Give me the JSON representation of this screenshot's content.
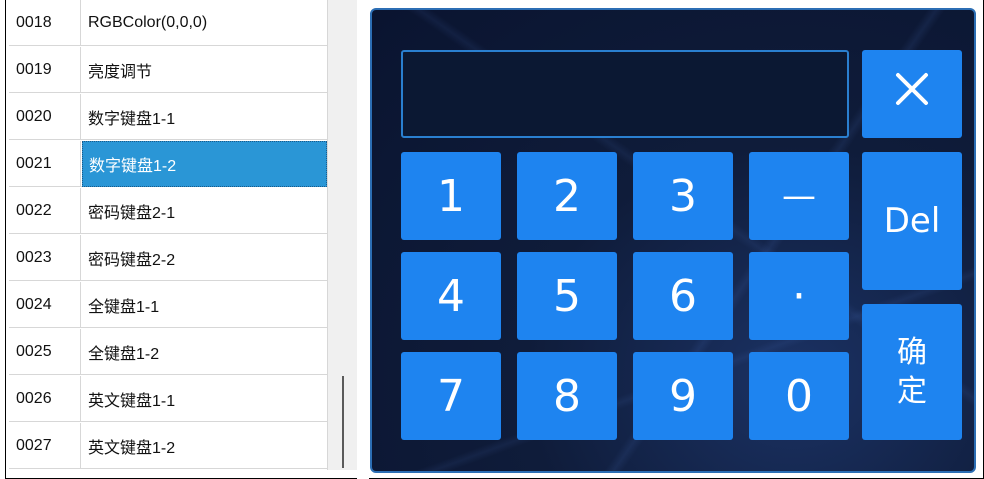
{
  "list": {
    "rows": [
      {
        "id": "0018",
        "name": "RGBColor(0,0,0)",
        "selected": false
      },
      {
        "id": "0019",
        "name": "亮度调节",
        "selected": false
      },
      {
        "id": "0020",
        "name": "数字键盘1-1",
        "selected": false
      },
      {
        "id": "0021",
        "name": "数字键盘1-2",
        "selected": true
      },
      {
        "id": "0022",
        "name": "密码键盘2-1",
        "selected": false
      },
      {
        "id": "0023",
        "name": "密码键盘2-2",
        "selected": false
      },
      {
        "id": "0024",
        "name": "全键盘1-1",
        "selected": false
      },
      {
        "id": "0025",
        "name": "全键盘1-2",
        "selected": false
      },
      {
        "id": "0026",
        "name": "英文键盘1-1",
        "selected": false
      },
      {
        "id": "0027",
        "name": "英文键盘1-2",
        "selected": false
      }
    ]
  },
  "keypad": {
    "display_value": "",
    "keys": {
      "k1": "1",
      "k2": "2",
      "k3": "3",
      "minus": "—",
      "k4": "4",
      "k5": "5",
      "k6": "6",
      "dot": "·",
      "k7": "7",
      "k8": "8",
      "k9": "9",
      "k0": "0",
      "del": "Del",
      "confirm_line1": "确",
      "confirm_line2": "定"
    },
    "close_icon": "close-x-icon"
  },
  "colors": {
    "selected_row": "#2a96d6",
    "key_blue": "#1e84f0",
    "panel_bg": "#0f1c3a",
    "panel_border": "#2c6eb4"
  }
}
